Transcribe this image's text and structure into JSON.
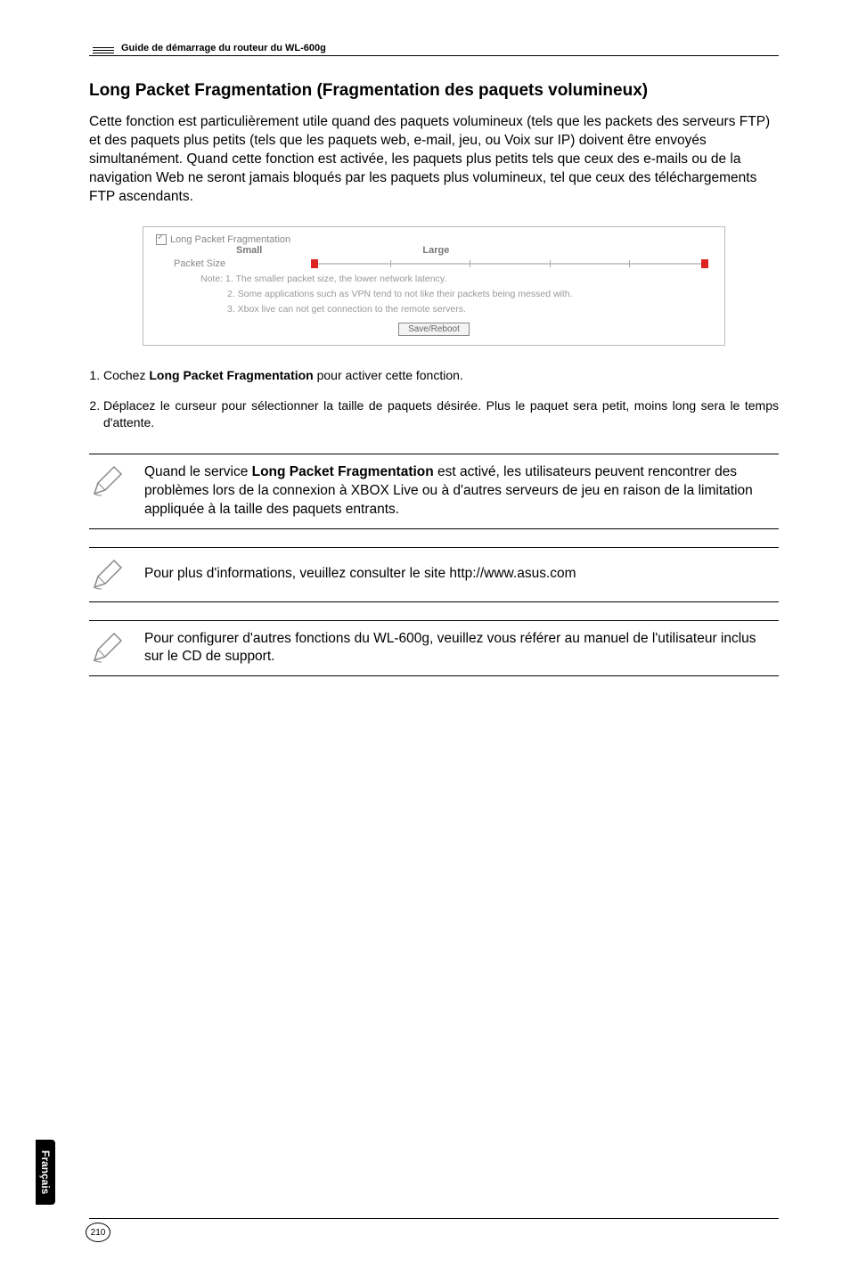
{
  "header": {
    "guide_title": "Guide de démarrage du routeur du WL-600g"
  },
  "section": {
    "title": "Long Packet Fragmentation (Fragmentation des paquets volumineux)",
    "intro": "Cette fonction est particulièrement utile quand des paquets volumineux (tels que les packets des serveurs FTP) et des paquets plus petits (tels que les paquets web, e-mail, jeu, ou Voix sur IP) doivent être envoyés simultanément. Quand cette fonction est activée, les paquets plus petits tels que ceux des e-mails ou de la navigation Web ne seront jamais bloqués par les paquets plus volumineux, tel que ceux des téléchargements FTP ascendants."
  },
  "screenshot": {
    "checkbox_label": "Long Packet Fragmentation",
    "col_small": "Small",
    "col_large": "Large",
    "row_label": "Packet Size",
    "note_line1": "Note: 1. The smaller packet size, the lower network latency.",
    "note_line2": "2. Some applications such as VPN tend to not like their packets being messed with.",
    "note_line3": "3. Xbox live can not get connection to the remote servers.",
    "button": "Save/Reboot"
  },
  "steps": {
    "s1_pre": "Cochez ",
    "s1_bold": "Long Packet Fragmentation",
    "s1_post": " pour activer cette fonction.",
    "s2": "Déplacez le curseur pour sélectionner la taille de paquets désirée. Plus le paquet sera petit, moins long sera le temps d'attente."
  },
  "notes": {
    "n1_pre": "Quand le service ",
    "n1_bold": "Long Packet Fragmentation",
    "n1_post": " est activé, les utilisateurs peuvent rencontrer des problèmes lors de la connexion à XBOX Live ou à d'autres serveurs de jeu en raison de la limitation appliquée à la taille des paquets entrants.",
    "n2": "Pour plus d'informations, veuillez consulter le site http://www.asus.com",
    "n3": "Pour configurer d'autres fonctions du WL-600g, veuillez vous référer au manuel de l'utilisateur inclus sur le CD de support."
  },
  "footer": {
    "lang_tab": "Français",
    "page_number": "210"
  }
}
